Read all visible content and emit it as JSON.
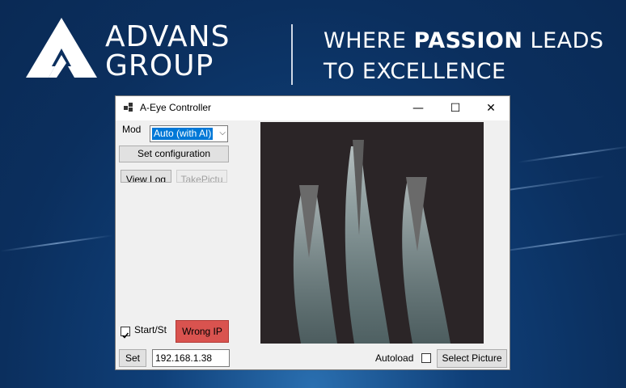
{
  "banner": {
    "brand_line1": "ADVANS",
    "brand_line2": "GROUP",
    "tagline_line1_pre": "WHERE ",
    "tagline_line1_bold": "PASSION",
    "tagline_line1_post": " LEADS",
    "tagline_line2": "TO EXCELLENCE"
  },
  "window": {
    "title": "A-Eye Controller",
    "minimize_glyph": "—",
    "maximize_glyph": "☐",
    "close_glyph": "✕"
  },
  "controls": {
    "mode_label": "Mod",
    "mode_selected": "Auto (with AI)",
    "set_config_label": "Set configuration",
    "view_log_label": "View Log",
    "take_picture_label": "TakePictu",
    "start_stop_label": "Start/St",
    "start_stop_checked": true,
    "wrong_ip_label": "Wrong IP",
    "wrong_ip_color": "#d9534f",
    "set_label": "Set",
    "ip_value": "192.168.1.38",
    "autoload_label": "Autoload",
    "autoload_checked": false,
    "select_picture_label": "Select Picture"
  },
  "colors": {
    "accent": "#0078d7",
    "window_bg": "#f0f0f0",
    "background": "#0b2f5e"
  }
}
